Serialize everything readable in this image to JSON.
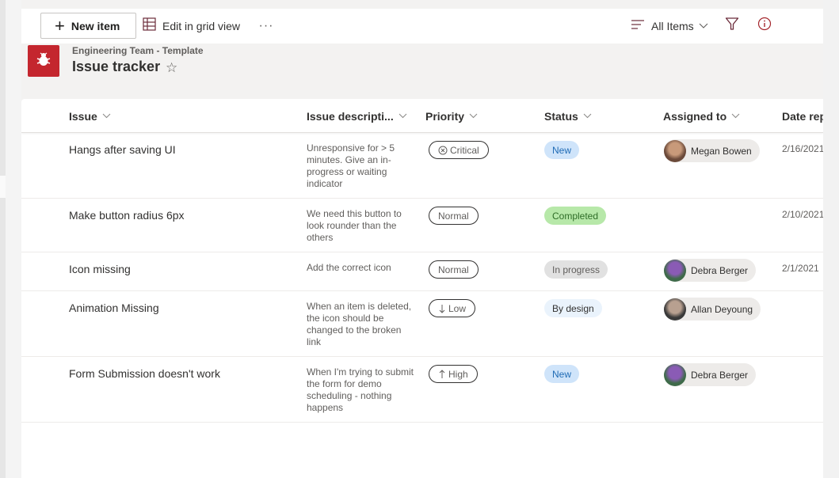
{
  "toolbar": {
    "new_item_label": "New item",
    "edit_grid_label": "Edit in grid view",
    "more_label": "···",
    "view_label": "All Items"
  },
  "site": {
    "subtitle": "Engineering Team - Template",
    "title": "Issue tracker",
    "logo_color": "#c4262e"
  },
  "columns": {
    "issue": "Issue",
    "description": "Issue descripti...",
    "priority": "Priority",
    "status": "Status",
    "assigned": "Assigned to",
    "date": "Date rep"
  },
  "rows": [
    {
      "issue": "Hangs after saving UI",
      "description": "Unresponsive for > 5 minutes. Give an in-progress or waiting indicator",
      "priority": "Critical",
      "priority_icon": "circle-x-icon",
      "status": "New",
      "status_bg": "#cfe4fa",
      "status_fg": "#1f6bb5",
      "assigned": "Megan Bowen",
      "date": "2/16/2021"
    },
    {
      "issue": "Make button radius 6px",
      "description": "We need this button to look rounder than the others",
      "priority": "Normal",
      "priority_icon": "",
      "status": "Completed",
      "status_bg": "#b7e8a9",
      "status_fg": "#2f6d28",
      "assigned": "",
      "date": "2/10/2021"
    },
    {
      "issue": "Icon missing",
      "description": "Add the correct icon",
      "priority": "Normal",
      "priority_icon": "",
      "status": "In progress",
      "status_bg": "#e1e1e1",
      "status_fg": "#605e5c",
      "assigned": "Debra Berger",
      "date": "2/1/2021"
    },
    {
      "issue": "Animation Missing",
      "description": "When an item is deleted, the icon should be changed to the broken link",
      "priority": "Low",
      "priority_icon": "arrow-down-icon",
      "status": "By design",
      "status_bg": "#eaf3fc",
      "status_fg": "#323130",
      "assigned": "Allan Deyoung",
      "date": ""
    },
    {
      "issue": "Form Submission doesn't work",
      "description": "When I'm trying to submit the form for demo scheduling - nothing happens",
      "priority": "High",
      "priority_icon": "arrow-up-icon",
      "status": "New",
      "status_bg": "#cfe4fa",
      "status_fg": "#1f6bb5",
      "assigned": "Debra Berger",
      "date": ""
    }
  ]
}
